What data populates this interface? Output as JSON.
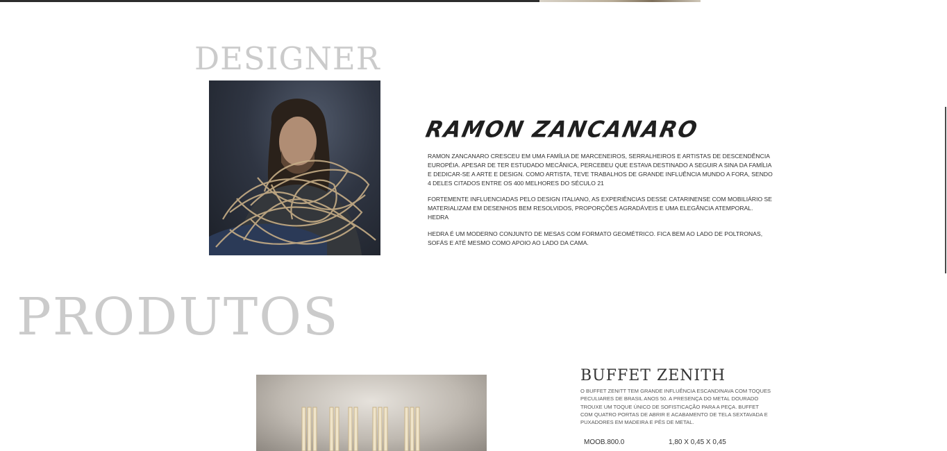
{
  "designer": {
    "section_title": "DESIGNER",
    "photo_alt": "Ramon Zancanaro",
    "name": "RAMON ZANCANARO",
    "bio": [
      "RAMON ZANCANARO CRESCEU EM UMA FAMÍLIA DE MARCENEIROS, SERRALHEIROS E ARTISTAS DE DESCENDÊNCIA EUROPÉIA. APESAR DE TER ESTUDADO MECÂNICA, PERCEBEU QUE ESTAVA DESTINADO A SEGUIR A SINA DA FAMÍLIA E DEDICAR-SE A ARTE E DESIGN. COMO ARTISTA, TEVE TRABALHOS DE GRANDE INFLUÊNCIA MUNDO A FORA, SENDO 4 DELES CITADOS ENTRE OS 400 MELHORES DO SÉCULO 21",
      "FORTEMENTE INFLUENCIADAS PELO DESIGN ITALIANO, AS EXPERIÊNCIAS DESSE CATARINENSE COM MOBILIÁRIO SE MATERIALIZAM EM DESENHOS BEM RESOLVIDOS, PROPORÇÕES AGRADÁVEIS E UMA ELEGÂNCIA ATEMPORAL. HEDRA",
      "HEDRA É UM MODERNO CONJUNTO DE MESAS COM FORMATO GEOMÉTRICO. FICA BEM AO LADO DE POLTRONAS, SOFÁS E ATÉ MESMO COMO APOIO AO LADO DA CAMA."
    ]
  },
  "products": {
    "section_title": "PRODUTOS",
    "items": [
      {
        "name": "BUFFET ZENITH",
        "description": "O BUFFET ZENITT TEM GRANDE INFLUÊNCIA ESCANDINAVA COM TOQUES PECULIARES DE BRASIL ANOS 50. A PRESENÇA DO METAL DOURADO TROUXE UM TOQUE ÚNICO DE SOFISTICAÇÃO PARA A PEÇA. BUFFET COM QUATRO PORTAS DE ABRIR E ACABAMENTO DE TELA SEXTAVADA E PUXADORES EM MADEIRA E PÉS DE METAL.",
        "code": "MOOB.800.0",
        "dimensions": "1,80 X 0,45 X 0,45"
      }
    ]
  },
  "colors": {
    "heading_gray": "#cbcbcb",
    "text_dark": "#2b2b2b",
    "top_bar": "#2d2d2d"
  }
}
